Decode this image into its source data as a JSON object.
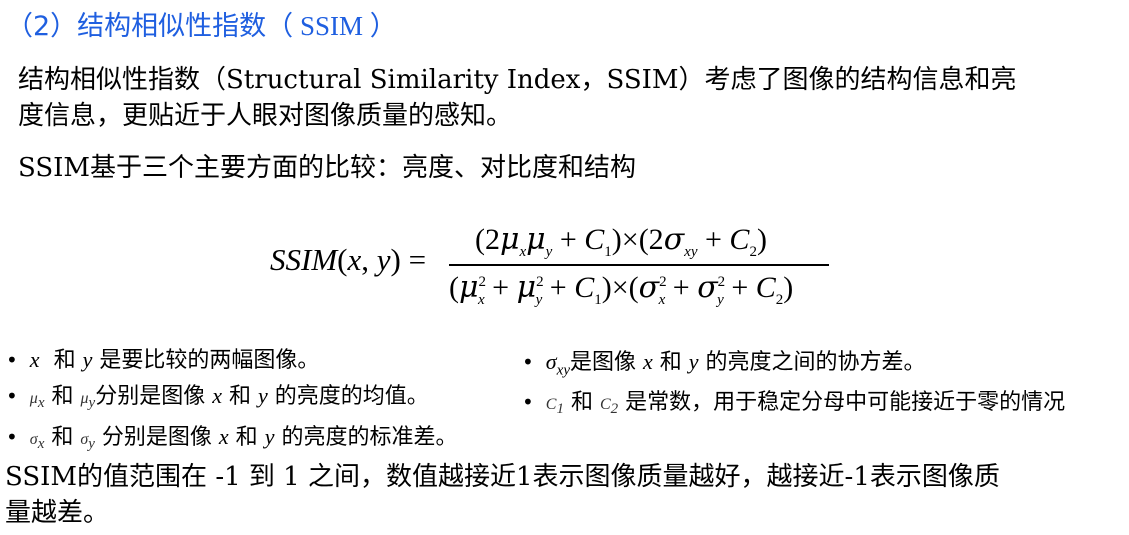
{
  "heading": {
    "prefix": "（2）结构相似性指数（",
    "ssim": " SSIM ",
    "suffix": "）"
  },
  "paragraphs": {
    "intro_line1": "结构相似性指数（Structural Similarity Index，SSIM）考虑了图像的结构信息和亮",
    "intro_line2": "度信息，更贴近于人眼对图像质量的感知。",
    "basis": "SSIM基于三个主要方面的比较：亮度、对比度和结构",
    "range_line1": "SSIM的值范围在 -1 到 1 之间，数值越接近1表示图像质量越好，越接近-1表示图像质",
    "range_line2": "量越差。"
  },
  "bullets": {
    "b1": {
      "text": "和 ",
      "tail": "是要比较的两幅图像。"
    },
    "b2": {
      "mid": " 和 ",
      "tail1": "分别是图像 ",
      "x": "x",
      "and": " 和 ",
      "y": "y",
      "tail2": " 的亮度的均值。"
    },
    "b3": {
      "mid": " 和 ",
      "tail1": " 分别是图像 ",
      "x": "x",
      "and": " 和 ",
      "y": "y",
      "tail2": " 的亮度的标准差。"
    },
    "b4": {
      "tail1": "是图像 ",
      "x": "x",
      "and": " 和 ",
      "y": "y",
      "tail2": " 的亮度之间的协方差。"
    },
    "b5": {
      "mid": "和 ",
      "tail": "是常数，用于稳定分母中可能接近于零的情况"
    }
  }
}
